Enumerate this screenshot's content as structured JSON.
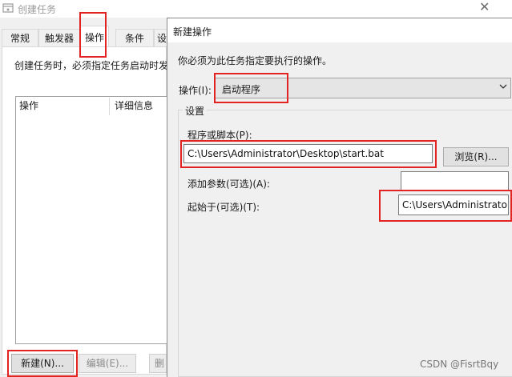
{
  "back_window": {
    "title": "创建任务",
    "tabs": [
      {
        "label": "常规"
      },
      {
        "label": "触发器"
      },
      {
        "label": "操作"
      },
      {
        "label": "条件"
      },
      {
        "label": "设"
      }
    ],
    "description": "创建任务时，必须指定任务启动时发",
    "list_columns": [
      "操作",
      "详细信息"
    ],
    "buttons": {
      "new": "新建(N)...",
      "edit": "编辑(E)...",
      "delete": "删"
    }
  },
  "dialog": {
    "title": "新建操作",
    "instruction": "你必须为此任务指定要执行的操作。",
    "action_label": "操作(I):",
    "action_value": "启动程序",
    "group_label": "设置",
    "program_label": "程序或脚本(P):",
    "program_value": "C:\\Users\\Administrator\\Desktop\\start.bat",
    "browse_button": "浏览(R)...",
    "args_label": "添加参数(可选)(A):",
    "args_value": "",
    "start_in_label": "起始于(可选)(T):",
    "start_in_value": "C:\\Users\\Administrato"
  },
  "watermark": "CSDN @FisrtBqy",
  "colors": {
    "highlight_box": "#e32222",
    "background": "#f0f0f0"
  }
}
